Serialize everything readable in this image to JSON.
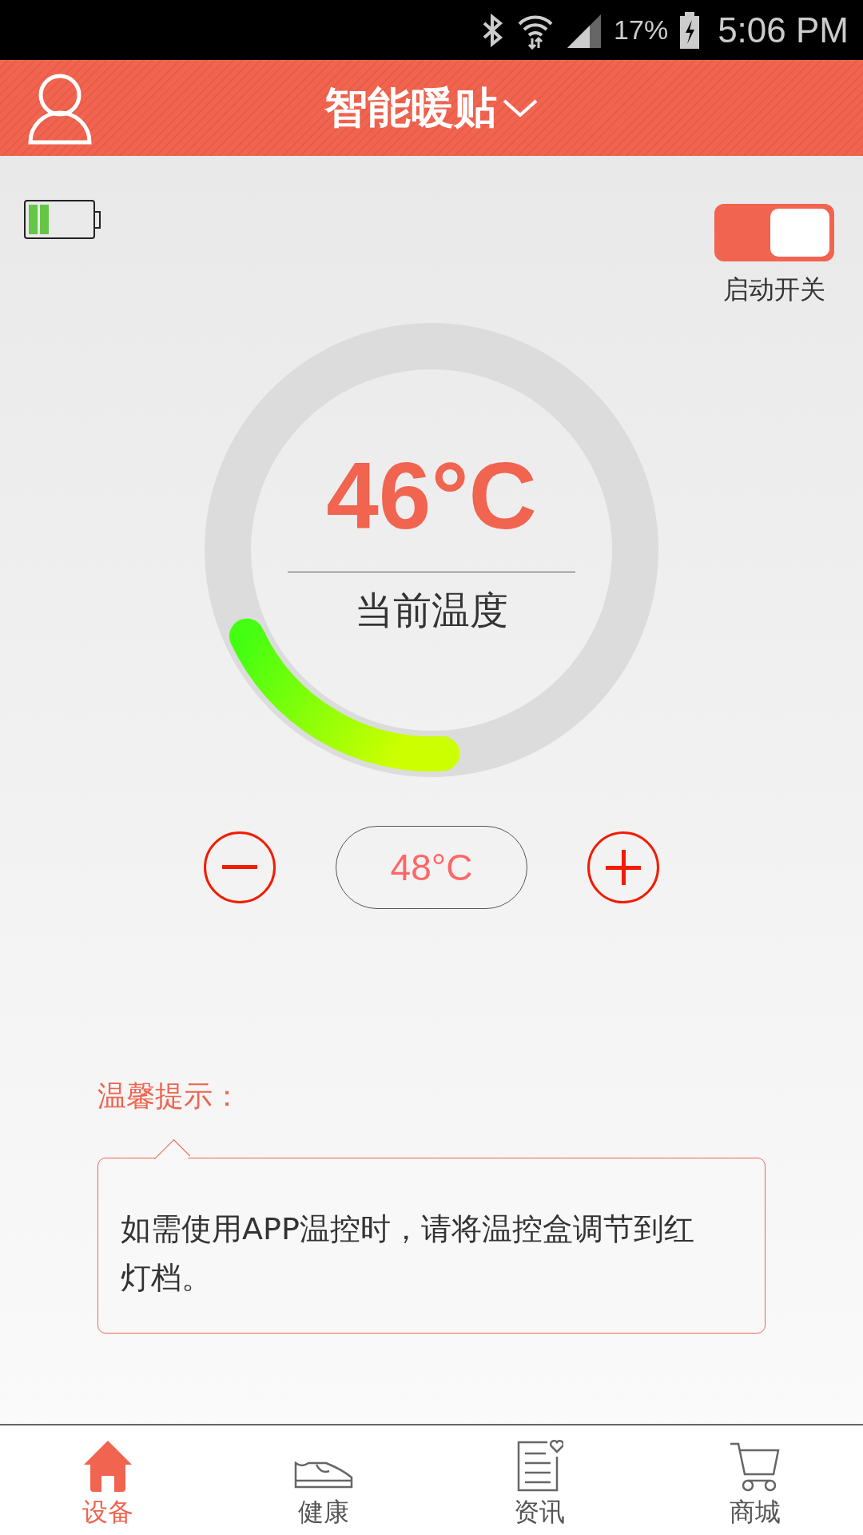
{
  "status_bar": {
    "battery": "17%",
    "time": "5:06 PM"
  },
  "header": {
    "title": "智能暖贴"
  },
  "device": {
    "power_switch": {
      "label": "启动开关",
      "on": true
    }
  },
  "gauge": {
    "temperature": "46°C",
    "caption": "当前温度"
  },
  "setpoint": {
    "value": "48°C"
  },
  "tip": {
    "title": "温馨提示：",
    "text": "如需使用APP温控时，请将温控盒调节到红灯档。"
  },
  "tabs": [
    {
      "label": "设备",
      "kind": "home",
      "selected": true
    },
    {
      "label": "健康",
      "kind": "shoe",
      "selected": false
    },
    {
      "label": "资讯",
      "kind": "news",
      "selected": false
    },
    {
      "label": "商城",
      "kind": "cart",
      "selected": false
    }
  ]
}
